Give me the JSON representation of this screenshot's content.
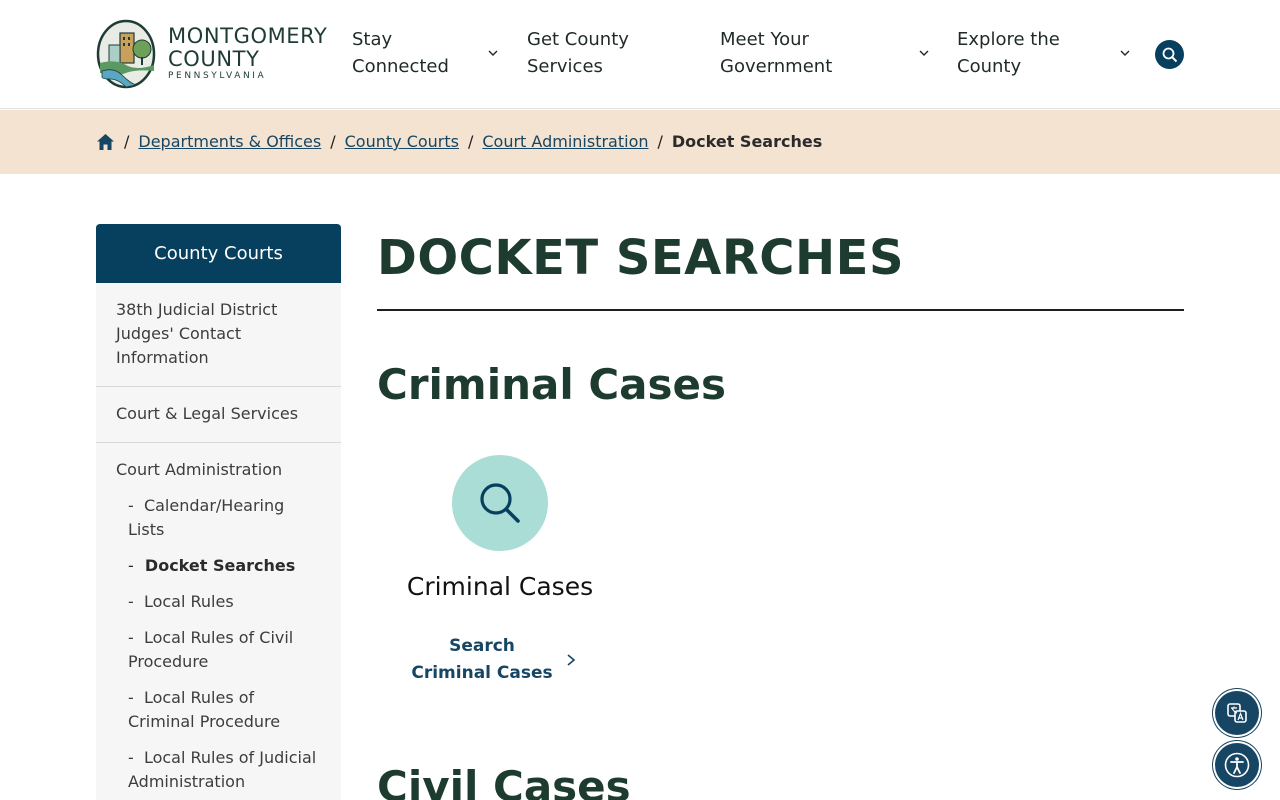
{
  "header": {
    "logo": {
      "line1": "MONTGOMERY",
      "line2": "COUNTY",
      "line3": "PENNSYLVANIA"
    },
    "nav": [
      {
        "line1": "Stay",
        "line2": "Connected",
        "has_dropdown": true
      },
      {
        "line1": "Get County",
        "line2": "Services",
        "has_dropdown": false
      },
      {
        "line1": "Meet Your",
        "line2": "Government",
        "has_dropdown": true
      },
      {
        "line1": "Explore the",
        "line2": "County",
        "has_dropdown": true
      }
    ],
    "search_icon": "search-icon"
  },
  "breadcrumb": {
    "home_icon": "home-icon",
    "items": [
      "Departments & Offices",
      "County Courts",
      "Court Administration"
    ],
    "current": "Docket Searches"
  },
  "sidebar": {
    "heading": "County Courts",
    "items": [
      {
        "label": "38th Judicial District Judges' Contact Information"
      },
      {
        "label": "Court & Legal Services"
      },
      {
        "label": "Court Administration"
      }
    ],
    "subitems": [
      {
        "label": "Calendar/Hearing Lists",
        "active": false
      },
      {
        "label": "Docket Searches",
        "active": true
      },
      {
        "label": "Local Rules",
        "active": false
      },
      {
        "label": "Local Rules of Civil Procedure",
        "active": false
      },
      {
        "label": "Local Rules of Criminal Procedure",
        "active": false
      },
      {
        "label": "Local Rules of Judicial Administration",
        "active": false
      }
    ],
    "sub_prefix": "-"
  },
  "main": {
    "page_title": "DOCKET SEARCHES",
    "sections": [
      {
        "title": "Criminal Cases",
        "card": {
          "icon": "search-icon",
          "title": "Criminal Cases",
          "link": "Search Criminal Cases"
        }
      },
      {
        "title": "Civil Cases"
      }
    ]
  },
  "floating": {
    "translate_icon": "translate-icon",
    "accessibility_icon": "accessibility-icon"
  },
  "colors": {
    "brand_navy": "#073f5e",
    "title_green": "#1e3b30",
    "breadcrumb_bg": "#f3e3d0",
    "icon_circle": "#a9ddd6",
    "link_blue": "#164663"
  }
}
